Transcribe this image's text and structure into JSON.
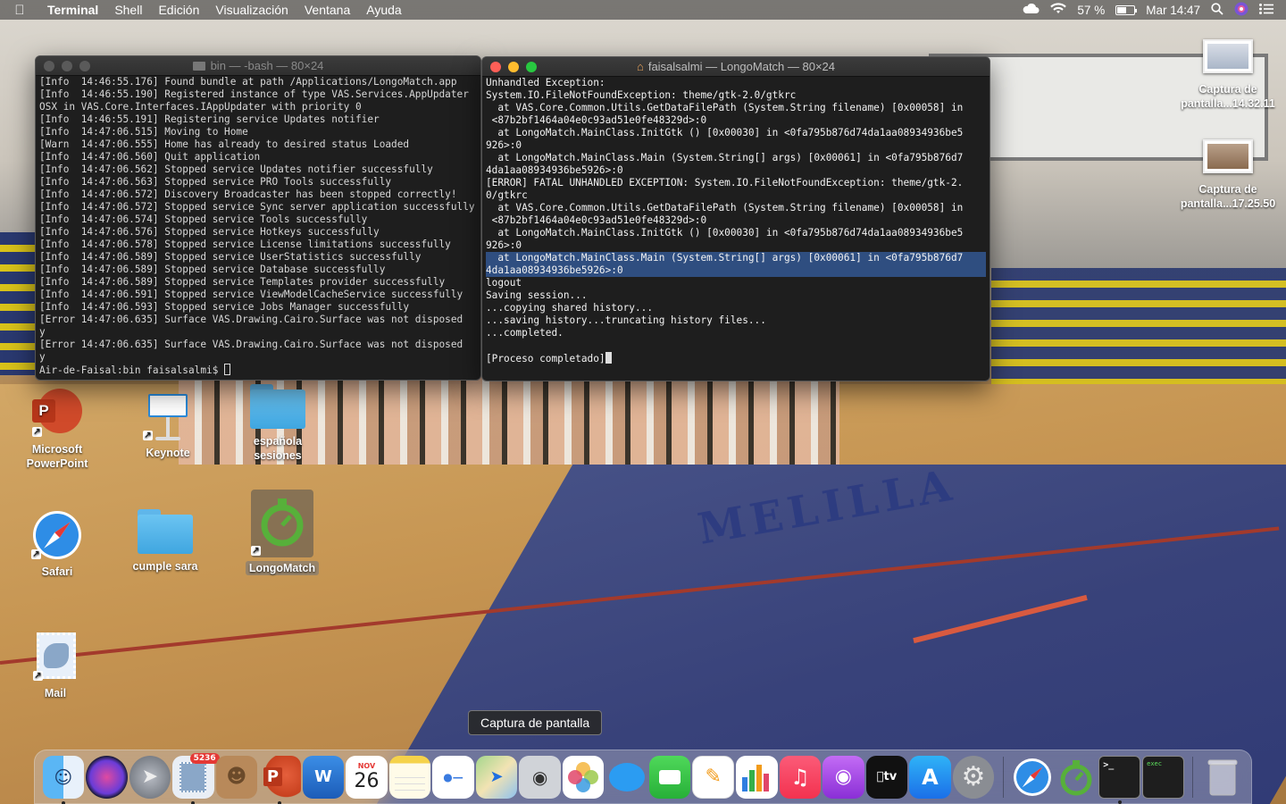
{
  "menubar": {
    "app": "Terminal",
    "items": [
      "Shell",
      "Edición",
      "Visualización",
      "Ventana",
      "Ayuda"
    ],
    "battery_percent": "57 %",
    "battery_level": 0.57,
    "clock": "Mar 14:47"
  },
  "term_left": {
    "title": "bin — -bash — 80×24",
    "lines": [
      "[Info  14:46:55.176] Found bundle at path /Applications/LongoMatch.app",
      "[Info  14:46:55.190] Registered instance of type VAS.Services.AppUpdater",
      "OSX in VAS.Core.Interfaces.IAppUpdater with priority 0",
      "[Info  14:46:55.191] Registering service Updates notifier",
      "[Info  14:47:06.515] Moving to Home",
      "[Warn  14:47:06.555] Home has already to desired status Loaded",
      "[Info  14:47:06.560] Quit application",
      "[Info  14:47:06.562] Stopped service Updates notifier successfully",
      "[Info  14:47:06.563] Stopped service PRO Tools successfully",
      "[Info  14:47:06.572] Discovery Broadcaster has been stopped correctly!",
      "[Info  14:47:06.572] Stopped service Sync server application successfully",
      "[Info  14:47:06.574] Stopped service Tools successfully",
      "[Info  14:47:06.576] Stopped service Hotkeys successfully",
      "[Info  14:47:06.578] Stopped service License limitations successfully",
      "[Info  14:47:06.589] Stopped service UserStatistics successfully",
      "[Info  14:47:06.589] Stopped service Database successfully",
      "[Info  14:47:06.589] Stopped service Templates provider successfully",
      "[Info  14:47:06.591] Stopped service ViewModelCacheService successfully",
      "[Info  14:47:06.593] Stopped service Jobs Manager successfully",
      "[Error 14:47:06.635] Surface VAS.Drawing.Cairo.Surface was not disposed",
      "y",
      "[Error 14:47:06.635] Surface VAS.Drawing.Cairo.Surface was not disposed",
      "y"
    ],
    "prompt": "Air-de-Faisal:bin faisalsalmi$ "
  },
  "term_right": {
    "title": "faisalsalmi — LongoMatch — 80×24",
    "lines": [
      "Unhandled Exception:",
      "System.IO.FileNotFoundException: theme/gtk-2.0/gtkrc",
      "  at VAS.Core.Common.Utils.GetDataFilePath (System.String filename) [0x00058] in",
      " <87b2bf1464a04e0c93ad51e0fe48329d>:0",
      "  at LongoMatch.MainClass.InitGtk () [0x00030] in <0fa795b876d74da1aa08934936be5",
      "926>:0",
      "  at LongoMatch.MainClass.Main (System.String[] args) [0x00061] in <0fa795b876d7",
      "4da1aa08934936be5926>:0",
      "[ERROR] FATAL UNHANDLED EXCEPTION: System.IO.FileNotFoundException: theme/gtk-2.",
      "0/gtkrc",
      "  at VAS.Core.Common.Utils.GetDataFilePath (System.String filename) [0x00058] in",
      " <87b2bf1464a04e0c93ad51e0fe48329d>:0",
      "  at LongoMatch.MainClass.InitGtk () [0x00030] in <0fa795b876d74da1aa08934936be5",
      "926>:0",
      "  at LongoMatch.MainClass.Main (System.String[] args) [0x00061] in <0fa795b876d7",
      "4da1aa08934936be5926>:0",
      "logout",
      "Saving session...",
      "...copying shared history...",
      "...saving history...truncating history files...",
      "...completed.",
      "",
      "[Proceso completado]"
    ],
    "selected_lines": [
      14,
      15
    ]
  },
  "desktop_icons": {
    "powerpoint": "Microsoft PowerPoint",
    "keynote": "Keynote",
    "espanola": "española sesiones",
    "safari": "Safari",
    "cumple": "cumple sara",
    "longomatch": "LongoMatch",
    "mail": "Mail",
    "capture1": "Captura de pantalla...14.32.11",
    "capture2": "Captura de pantalla...17.25.50"
  },
  "tooltip": "Captura de pantalla",
  "dock": {
    "mail_badge": "5236",
    "calendar_month": "NOV",
    "calendar_day": "26",
    "terminal_label": "exec"
  }
}
